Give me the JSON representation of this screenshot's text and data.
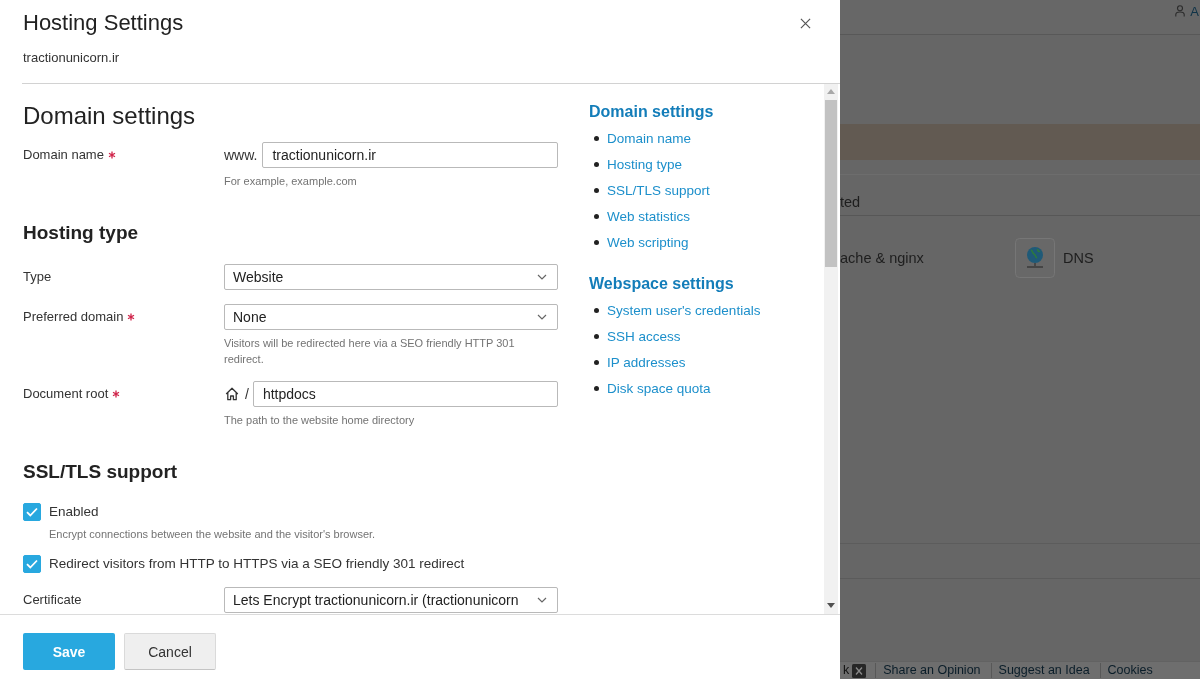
{
  "dialog": {
    "title": "Hosting Settings",
    "subtitle": "tractionunicorn.ir"
  },
  "form": {
    "title": "Domain settings",
    "items": [
      {
        "kind": "prefixed-input",
        "label": "Domain name",
        "required": true,
        "prefix": "www.",
        "value": "tractionunicorn.ir",
        "hint": "For example, example.com"
      },
      {
        "kind": "heading",
        "text": "Hosting type"
      },
      {
        "kind": "select",
        "label": "Type",
        "required": false,
        "value": "Website"
      },
      {
        "kind": "select",
        "label": "Preferred domain",
        "required": true,
        "value": "None",
        "hint": "Visitors will be redirected here via a SEO friendly HTTP 301 redirect."
      },
      {
        "kind": "path-input",
        "label": "Document root",
        "required": true,
        "prefix": "/",
        "value": "httpdocs",
        "hint": "The path to the website home directory"
      },
      {
        "kind": "heading",
        "text": "SSL/TLS support"
      },
      {
        "kind": "checkbox",
        "label": "Enabled",
        "checked": true,
        "hint": "Encrypt connections between the website and the visitor's browser."
      },
      {
        "kind": "checkbox",
        "label": "Redirect visitors from HTTP to HTTPS via a SEO friendly 301 redirect",
        "checked": true
      },
      {
        "kind": "select",
        "label": "Certificate",
        "required": false,
        "value": "Lets Encrypt tractionunicorn.ir (tractionunicorn"
      }
    ]
  },
  "navigation": {
    "groups": [
      {
        "title": "Domain settings",
        "links": [
          "Domain name",
          "Hosting type",
          "SSL/TLS support",
          "Web statistics",
          "Web scripting"
        ]
      },
      {
        "title": "Webspace settings",
        "links": [
          "System user's credentials",
          "SSH access",
          "IP addresses",
          "Disk space quota"
        ]
      }
    ]
  },
  "buttons": [
    {
      "label": "Save",
      "kind": "primary"
    },
    {
      "label": "Cancel",
      "kind": "secondary"
    }
  ],
  "background_page": {
    "user_menu": "A",
    "tab_label": "ted",
    "services": [
      {
        "label": "ache & nginx",
        "kind": "text"
      },
      {
        "label": "DNS",
        "kind": "tile"
      }
    ],
    "footer_fragment": "k",
    "footer_links": [
      "Share an Opinion",
      "Suggest an Idea",
      "Cookies"
    ]
  }
}
